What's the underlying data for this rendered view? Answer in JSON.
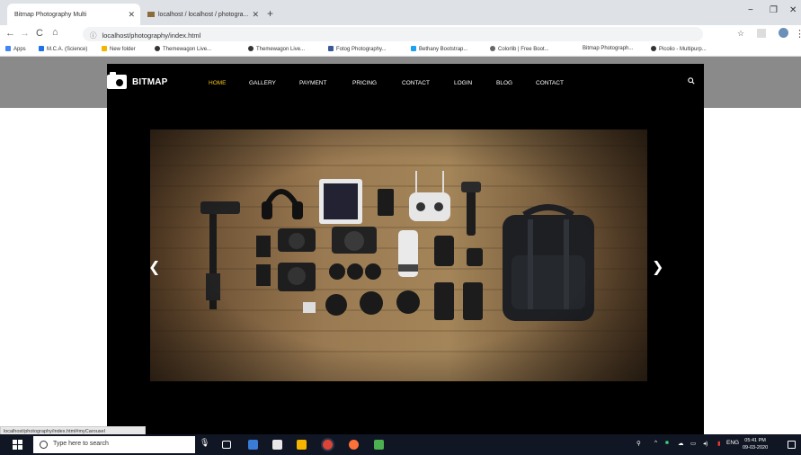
{
  "browser": {
    "tabs": [
      {
        "label": "Bitmap Photography Multi",
        "active": true
      },
      {
        "label": "localhost / localhost / photogra...",
        "active": false
      }
    ],
    "new_tab": "+",
    "window_controls": {
      "minimize": "−",
      "maximize": "❐",
      "close": "✕"
    },
    "nav": {
      "back": "←",
      "forward": "→",
      "reload": "C",
      "home": "⌂"
    },
    "url": "localhost/photography/index.html",
    "bookmarks": [
      {
        "label": "Apps",
        "color": "#4285f4"
      },
      {
        "label": "M.C.A. (Science)",
        "color": "#1a73e8"
      },
      {
        "label": "New folder",
        "color": "#f4b400"
      },
      {
        "label": "Themewagon Live...",
        "color": "#333333"
      },
      {
        "label": "Themewagon Live...",
        "color": "#333333"
      },
      {
        "label": "Fotog Photography...",
        "color": "#3b5998"
      },
      {
        "label": "Bethany Bootstrap...",
        "color": "#1da1f2"
      },
      {
        "label": "Colorlib | Free Boot...",
        "color": "#666666"
      },
      {
        "label": "Bitmap Photograph...",
        "color": "#ffffff"
      },
      {
        "label": "Picolio - Multipurp...",
        "color": "#333333"
      }
    ]
  },
  "site": {
    "brand": "BITMAP",
    "menu": [
      {
        "label": "HOME",
        "active": true
      },
      {
        "label": "GALLERY",
        "active": false
      },
      {
        "label": "PAYMENT",
        "active": false
      },
      {
        "label": "PRICING",
        "active": false
      },
      {
        "label": "CONTACT",
        "active": false
      },
      {
        "label": "LOGIN",
        "active": false
      },
      {
        "label": "BLOG",
        "active": false
      },
      {
        "label": "CONTACT",
        "active": false
      }
    ],
    "slider": {
      "prev": "❮",
      "next": "❯"
    },
    "accent_color": "#f2c21a"
  },
  "status_url": "localhost/photography/index.html#myCarousel",
  "taskbar": {
    "search_placeholder": "Type here to search",
    "tray_lang": "ENG",
    "time": "05:41 PM",
    "date": "09-03-2020"
  }
}
